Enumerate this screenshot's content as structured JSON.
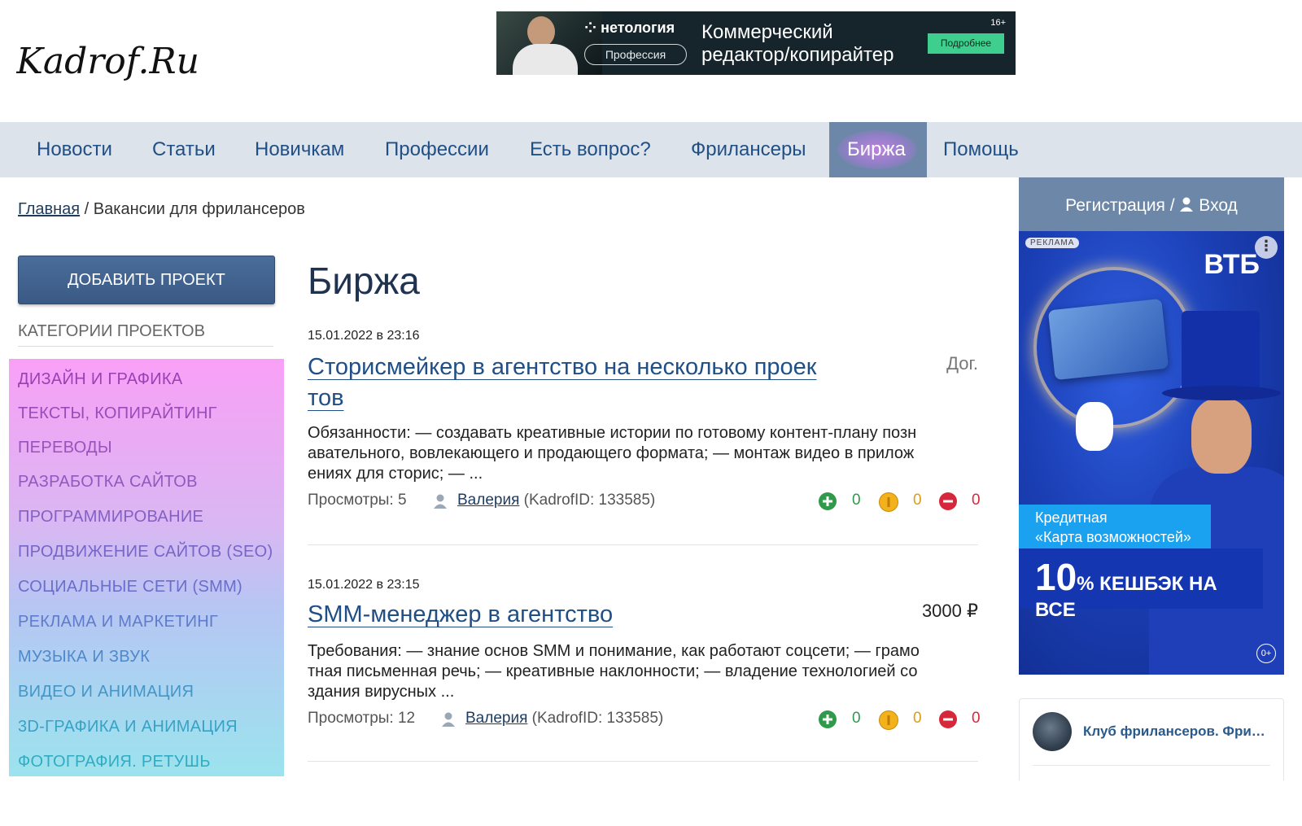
{
  "logo_text": "Kadrof.Ru",
  "top_banner": {
    "brand": "нетология",
    "brand_pill": "Профессия",
    "headline_line1": "Коммерческий",
    "headline_line2": "редактор/копирайтер",
    "age": "16+",
    "more_label": "Подробнее"
  },
  "nav": {
    "items": [
      {
        "label": "Новости"
      },
      {
        "label": "Статьи"
      },
      {
        "label": "Новичкам"
      },
      {
        "label": "Профессии"
      },
      {
        "label": "Есть вопрос?"
      },
      {
        "label": "Фрилансеры"
      },
      {
        "label": "Биржа",
        "active": true
      },
      {
        "label": "Помощь"
      }
    ]
  },
  "breadcrumb": {
    "home": "Главная",
    "separator": " / ",
    "current": "Вакансии для фрилансеров"
  },
  "sidebar": {
    "add_project": "ДОБАВИТЬ ПРОЕКТ",
    "categories_title": "КАТЕГОРИИ ПРОЕКТОВ",
    "categories": [
      {
        "label": "ДИЗАЙН И ГРАФИКА",
        "color": "#9b3fb5"
      },
      {
        "label": "ТЕКСТЫ, КОПИРАЙТИНГ",
        "color": "#9b4ab9"
      },
      {
        "label": "ПЕРЕВОДЫ",
        "color": "#9a52bb"
      },
      {
        "label": "РАЗРАБОТКА САЙТОВ",
        "color": "#9058c0"
      },
      {
        "label": "ПРОГРАММИРОВАНИЕ",
        "color": "#8360c4"
      },
      {
        "label": "ПРОДВИЖЕНИЕ САЙТОВ (SEO)",
        "color": "#7566c8"
      },
      {
        "label": "СОЦИАЛЬНЫЕ СЕТИ (SMM)",
        "color": "#686ecb"
      },
      {
        "label": "РЕКЛАМА И МАРКЕТИНГ",
        "color": "#5f7bcb"
      },
      {
        "label": "МУЗЫКА И ЗВУК",
        "color": "#5088c9"
      },
      {
        "label": "ВИДЕО И АНИМАЦИЯ",
        "color": "#4396c7"
      },
      {
        "label": "3D-ГРАФИКА И АНИМАЦИЯ",
        "color": "#38a2c4"
      },
      {
        "label": "ФОТОГРАФИЯ. РЕТУШЬ",
        "color": "#30acc2"
      }
    ]
  },
  "main": {
    "title": "Биржа",
    "posts": [
      {
        "date": "15.01.2022 в 23:16",
        "title_line1": "Сторисмейкер в агентство на несколько проек",
        "title_line2": "тов",
        "price": "Дог.",
        "desc_lines": [
          "Обязанности: — создавать креативные истории по готовому контент-плану позн",
          "авательного, вовлекающего и продающего формата; — монтаж видео в прилож",
          "ениях для сторис; — ..."
        ],
        "views": "Просмотры: 5",
        "author": "Валерия",
        "author_id": "(KadrofID: 133585)",
        "votes_plus": "0",
        "votes_neutral": "0",
        "votes_minus": "0"
      },
      {
        "date": "15.01.2022 в 23:15",
        "title_line1": "SMM-менеджер в агентство",
        "price": "3000 ₽",
        "desc_lines": [
          "Требования: — знание основ SMM и понимание, как работают соцсети; — грамо",
          "тная письменная речь; — креативные наклонности; — владение технологией со",
          "здания вирусных ..."
        ],
        "views": "Просмотры: 12",
        "author": "Валерия",
        "author_id": "(KadrofID: 133585)",
        "votes_plus": "0",
        "votes_neutral": "0",
        "votes_minus": "0"
      }
    ]
  },
  "right": {
    "auth_label": "Регистрация /",
    "login_label": "Вход",
    "ad": {
      "badge": "РЕКЛАМА",
      "menu": "⋮",
      "brand": "ВТБ",
      "strip_line1": "Кредитная",
      "strip_line2": "«Карта возможностей»",
      "big": "10",
      "big_rest": "% КЕШБЭК НА ВСЕ",
      "age": "0+"
    },
    "club_name": "Клуб фрилансеров. Фрил..."
  },
  "colors": {
    "nav_bg": "#dde3ea",
    "nav_active": "#6d87a8",
    "link": "#1f4f86",
    "vote_plus": "#2e9a4a",
    "vote_neutral": "#e09a14",
    "vote_minus": "#d6283a"
  }
}
